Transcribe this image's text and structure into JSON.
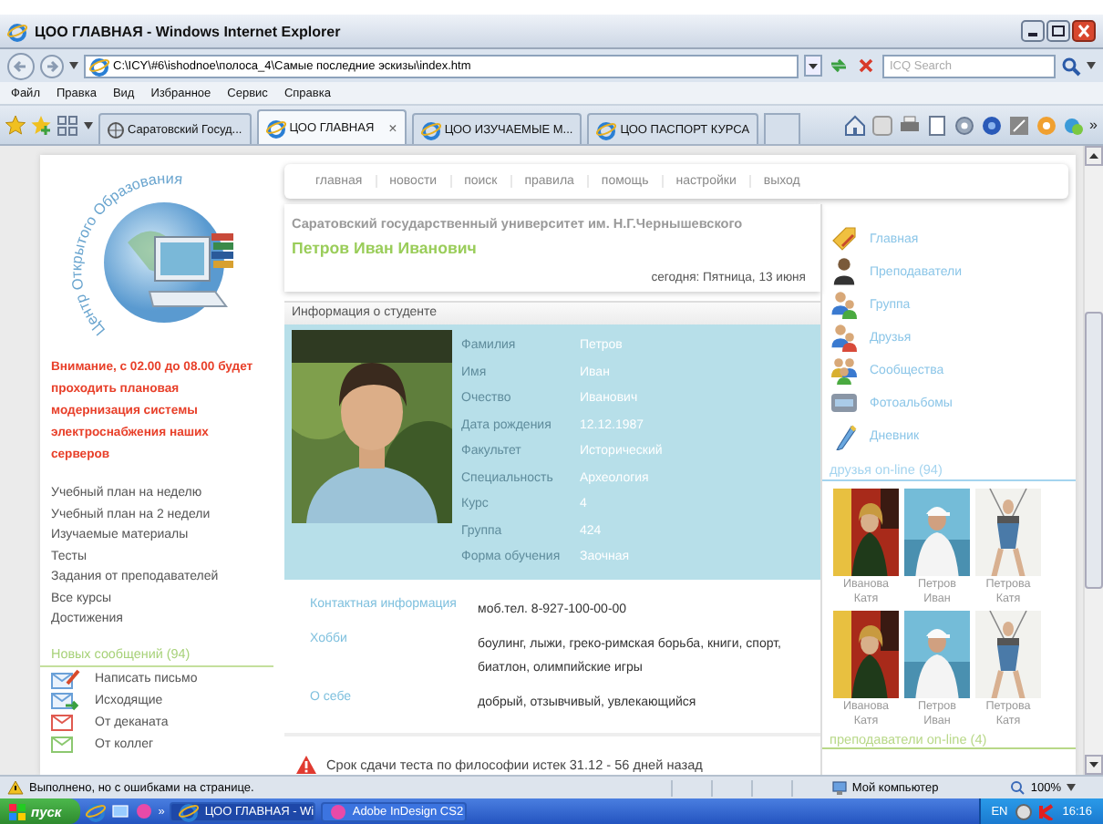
{
  "window": {
    "title": "ЦОО ГЛАВНАЯ - Windows Internet Explorer"
  },
  "address_bar": {
    "url": "C:\\ICY\\#6\\ishodnoe\\полоса_4\\Самые последние эскизы\\index.htm",
    "search": {
      "placeholder": "ICQ Search"
    }
  },
  "menu": [
    "Файл",
    "Правка",
    "Вид",
    "Избранное",
    "Сервис",
    "Справка"
  ],
  "browser_tabs": {
    "more": "»",
    "items": [
      {
        "label": "Саратовский Госуд...",
        "selected": false
      },
      {
        "label": "ЦОО ГЛАВНАЯ",
        "selected": true,
        "close": "×"
      },
      {
        "label": "ЦОО ИЗУЧАЕМЫЕ М...",
        "selected": false
      },
      {
        "label": "ЦОО ПАСПОРТ КУРСА",
        "selected": false
      }
    ]
  },
  "page": {
    "logo_text": "Центр Открытого Образования",
    "nav": [
      "главная",
      "новости",
      "поиск",
      "правила",
      "помощь",
      "настройки",
      "выход"
    ],
    "university": "Саратовский государственный университет им. Н.Г.Чернышевского",
    "user_name": "Петров Иван Иванович",
    "date": "сегодня: Пятница, 13 июня",
    "notice": "Внимание, с 02.00 до 08.00 будет проходить плановая модернизация системы электроснабжения наших серверов",
    "left_links": [
      "Учебный план на неделю",
      "Учебный план на 2 недели",
      "Изучаемые материалы",
      "Тесты",
      "Задания от преподавателей",
      "Все курсы",
      "Достижения"
    ],
    "messages": {
      "title": "Новых сообщений (94)",
      "items": [
        {
          "label": "Написать письмо",
          "kind": "compose"
        },
        {
          "label": "Исходящие",
          "kind": "outbox"
        },
        {
          "label": "От деканата",
          "kind": "mail",
          "color": "#e05a50"
        },
        {
          "label": "От коллег",
          "kind": "mail",
          "color": "#8cc870"
        }
      ]
    },
    "student_info": {
      "title": "Информация о студенте",
      "fields": [
        {
          "label": "Фамилия",
          "value": "Петров"
        },
        {
          "label": "Имя",
          "value": "Иван"
        },
        {
          "label": "Очество",
          "value": "Иванович"
        },
        {
          "label": "Дата рождения",
          "value": "12.12.1987"
        },
        {
          "label": "Факультет",
          "value": "Исторический"
        },
        {
          "label": "Специальность",
          "value": "Археология"
        },
        {
          "label": "Курс",
          "value": "4"
        },
        {
          "label": "Группа",
          "value": "424"
        },
        {
          "label": "Форма обучения",
          "value": "Заочная"
        }
      ]
    },
    "profile": [
      {
        "label": "Контактная информация",
        "value": "моб.тел. 8-927-100-00-00"
      },
      {
        "label": "Хобби",
        "value": "боулинг, лыжи, греко-римская борьба, книги, спорт, биатлон, олимпийские игры"
      },
      {
        "label": "О себе",
        "value": "добрый, отзывчивый, увлекающийся"
      }
    ],
    "alerts": [
      "Срок сдачи теста по философии истек 31.12 - 56 дней назад"
    ],
    "side_menu": [
      {
        "label": "Главная",
        "kind": "home"
      },
      {
        "label": "Преподаватели",
        "kind": "teacher"
      },
      {
        "label": "Группа",
        "kind": "group"
      },
      {
        "label": "Друзья",
        "kind": "friends"
      },
      {
        "label": "Сообщества",
        "kind": "community"
      },
      {
        "label": "Фотоальбомы",
        "kind": "album"
      },
      {
        "label": "Дневник",
        "kind": "diary"
      }
    ],
    "friends_online": {
      "title": "друзья on-line (94)",
      "friends": [
        {
          "name": "Иванова Катя"
        },
        {
          "name": "Петров Иван"
        },
        {
          "name": "Петрова Катя"
        },
        {
          "name": "Иванова Катя"
        },
        {
          "name": "Петров Иван"
        },
        {
          "name": "Петрова Катя"
        }
      ]
    },
    "teachers_online": {
      "title": "преподаватели on-line (4)"
    }
  },
  "status_bar": {
    "message": "Выполнено, но с ошибками на странице.",
    "zone": "Мой компьютер",
    "zoom": "100%"
  },
  "taskbar": {
    "start": "пуск",
    "more": "»",
    "windows": [
      {
        "label": "ЦОО ГЛАВНАЯ - Wi",
        "selected": true
      },
      {
        "label": "Adobe InDesign CS2",
        "selected": false
      }
    ],
    "language": "EN",
    "time": "16:16"
  }
}
